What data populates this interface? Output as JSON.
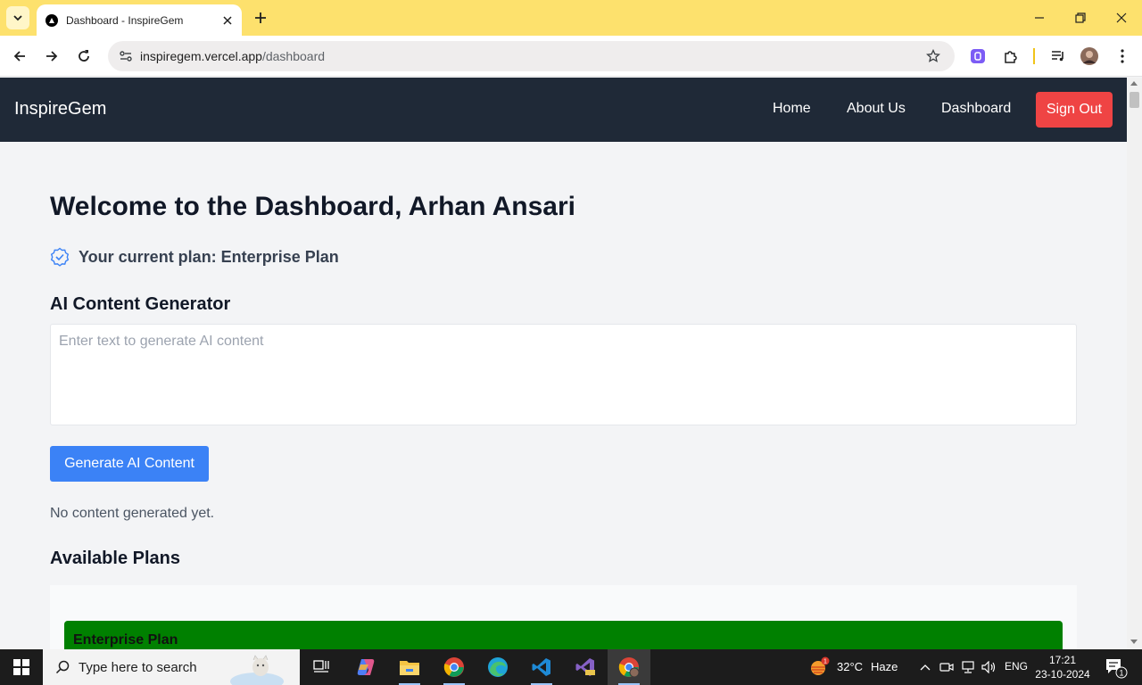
{
  "browser": {
    "tab_title": "Dashboard - InspireGem",
    "url_host": "inspiregem.vercel.app",
    "url_path": "/dashboard"
  },
  "nav": {
    "brand": "InspireGem",
    "links": [
      "Home",
      "About Us",
      "Dashboard"
    ],
    "signout": "Sign Out"
  },
  "dashboard": {
    "welcome": "Welcome to the Dashboard, Arhan Ansari",
    "plan_text": "Your current plan: Enterprise Plan",
    "generator_heading": "AI Content Generator",
    "prompt_placeholder": "Enter text to generate AI content",
    "prompt_value": "",
    "generate_button": "Generate AI Content",
    "status": "No content generated yet.",
    "plans_heading": "Available Plans",
    "plans": [
      {
        "name": "Enterprise Plan",
        "color": "#008000"
      }
    ]
  },
  "taskbar": {
    "search_placeholder": "Type here to search",
    "weather_temp": "32°C",
    "weather_desc": "Haze",
    "weather_badge": "1",
    "language": "ENG",
    "time": "17:21",
    "date": "23-10-2024",
    "notification_count": "1"
  },
  "colors": {
    "tabstrip": "#fde16d",
    "nav_bg": "#1f2937",
    "signout": "#ef4444",
    "primary": "#3b82f6"
  }
}
